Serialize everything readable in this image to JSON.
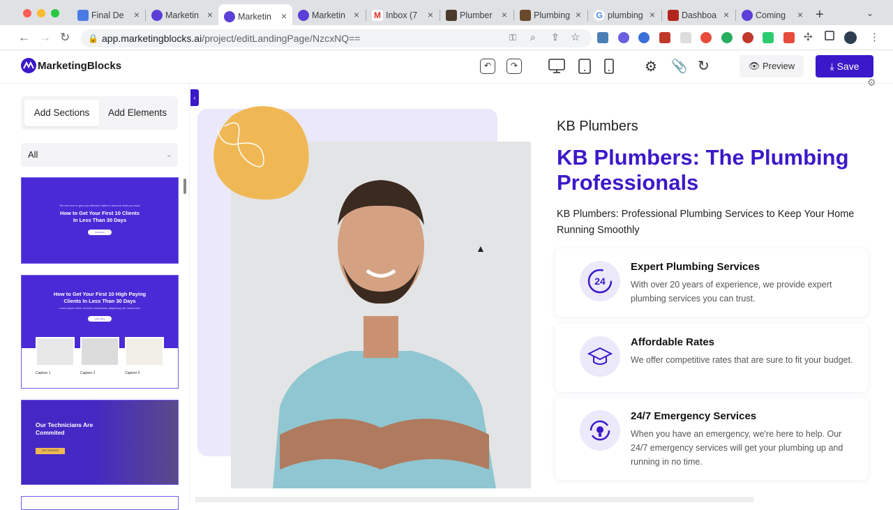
{
  "browser": {
    "tabs": [
      {
        "label": "Final De"
      },
      {
        "label": "Marketin"
      },
      {
        "label": "Marketin"
      },
      {
        "label": "Marketin"
      },
      {
        "label": "Inbox (7"
      },
      {
        "label": "Plumber"
      },
      {
        "label": "Plumbing"
      },
      {
        "label": "plumbing"
      },
      {
        "label": "Dashboa"
      },
      {
        "label": "Coming"
      }
    ],
    "new_tab": "+",
    "url_domain": "app.marketingblocks.ai",
    "url_path": "/project/editLandingPage/NzcxNQ=="
  },
  "app": {
    "logo": "MarketingBlocks",
    "preview_label": "Preview",
    "save_label": "Save"
  },
  "panel": {
    "tab_sections": "Add Sections",
    "tab_elements": "Add Elements",
    "filter_value": "All",
    "thumbs": [
      {
        "small": "We are here to give you effective sales to become what you want",
        "title1": "How to Get Your First 10 Clients",
        "title2": "In Less Than 30 Days",
        "button": "Find More"
      },
      {
        "title1": "How to Get Your First 10 High Paying",
        "title2": "Clients In Less Than 30 Days",
        "small": "Lorem ipsum dolor sit amet consectetur adipiscing elit, luctus erat.",
        "button": "Learn More",
        "captions": [
          "Caption 1",
          "Caption 2",
          "Caption 3"
        ]
      },
      {
        "title1": "Our Technicians Are",
        "title2": "Commited",
        "button": "GET STARTED"
      }
    ]
  },
  "page": {
    "brand": "KB Plumbers",
    "title": "KB Plumbers: The Plumbing Professionals",
    "description": "KB Plumbers: Professional Plumbing Services to Keep Your Home Running Smoothly",
    "features": [
      {
        "title": "Expert Plumbing Services",
        "desc": "With over 20 years of experience, we provide expert plumbing services you can trust.",
        "icon": "24-hours-icon"
      },
      {
        "title": "Affordable Rates",
        "desc": "We offer competitive rates that are sure to fit your budget.",
        "icon": "graduation-cap-icon"
      },
      {
        "title": "24/7 Emergency Services",
        "desc": "When you have an emergency, we're here to help. Our 24/7 emergency services will get your plumbing up and running in no time.",
        "icon": "refresh-bulb-icon"
      }
    ]
  },
  "colors": {
    "brand": "#3b18c9",
    "accent_blob": "#f0b855",
    "tabbar": "#dfe1e5"
  }
}
